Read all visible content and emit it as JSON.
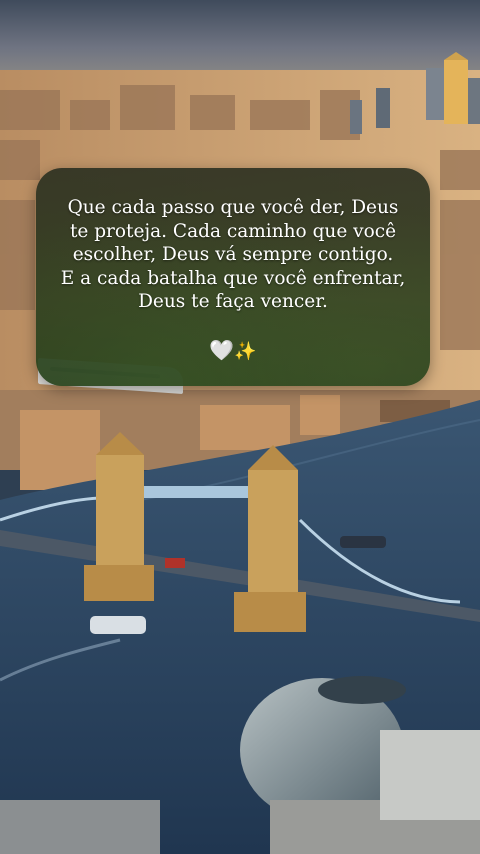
{
  "quote": {
    "lines": [
      "Que cada passo que você der, Deus",
      "te proteja. Cada caminho que você",
      "escolher, Deus vá sempre contigo.",
      "E a cada batalha que você enfrentar,",
      "Deus te faça vencer."
    ],
    "heart": "🤍",
    "sparkles": "✨"
  },
  "colors": {
    "river": "#2f4a66",
    "sky": "#4d5a6e",
    "bridge_stone": "#c9a15c",
    "bridge_cables": "#a9c6dc",
    "card": "#28361f"
  },
  "icons": [
    "white-heart-icon",
    "sparkles-icon"
  ]
}
